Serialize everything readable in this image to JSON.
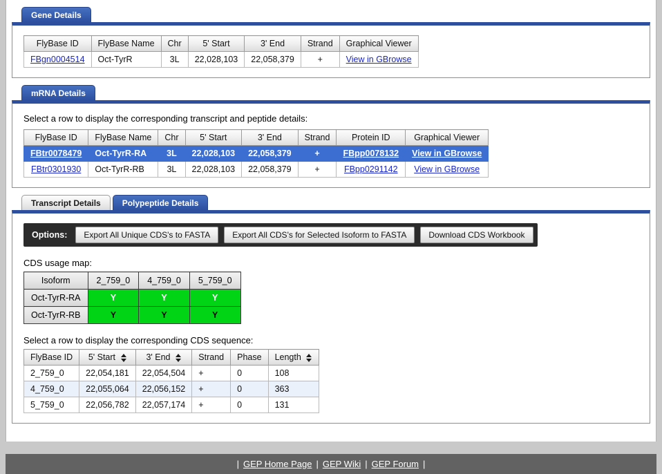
{
  "gene_panel": {
    "tab_label": "Gene Details",
    "columns": [
      "FlyBase ID",
      "FlyBase Name",
      "Chr",
      "5' Start",
      "3' End",
      "Strand",
      "Graphical Viewer"
    ],
    "rows": [
      {
        "flybase_id": "FBgn0004514",
        "flybase_name": "Oct-TyrR",
        "chr": "3L",
        "start": "22,028,103",
        "end": "22,058,379",
        "strand": "+",
        "viewer": "View in GBrowse"
      }
    ]
  },
  "mrna_panel": {
    "tab_label": "mRNA Details",
    "note": "Select a row to display the corresponding transcript and peptide details:",
    "columns": [
      "FlyBase ID",
      "FlyBase Name",
      "Chr",
      "5' Start",
      "3' End",
      "Strand",
      "Protein ID",
      "Graphical Viewer"
    ],
    "rows": [
      {
        "flybase_id": "FBtr0078479",
        "flybase_name": "Oct-TyrR-RA",
        "chr": "3L",
        "start": "22,028,103",
        "end": "22,058,379",
        "strand": "+",
        "protein_id": "FBpp0078132",
        "viewer": "View in GBrowse",
        "selected": true
      },
      {
        "flybase_id": "FBtr0301930",
        "flybase_name": "Oct-TyrR-RB",
        "chr": "3L",
        "start": "22,028,103",
        "end": "22,058,379",
        "strand": "+",
        "protein_id": "FBpp0291142",
        "viewer": "View in GBrowse",
        "selected": false
      }
    ]
  },
  "detail_panel": {
    "tabs": [
      {
        "label": "Transcript Details",
        "active": false
      },
      {
        "label": "Polypeptide Details",
        "active": true
      }
    ],
    "toolbar": {
      "label": "Options:",
      "buttons": [
        "Export All Unique CDS's to FASTA",
        "Export All CDS's for Selected Isoform to FASTA",
        "Download CDS Workbook"
      ]
    },
    "usage_map": {
      "title": "CDS usage map:",
      "columns": [
        "Isoform",
        "2_759_0",
        "4_759_0",
        "5_759_0"
      ],
      "rows": [
        {
          "isoform": "Oct-TyrR-RA",
          "cells": [
            "Y",
            "Y",
            "Y"
          ],
          "text_color": "white"
        },
        {
          "isoform": "Oct-TyrR-RB",
          "cells": [
            "Y",
            "Y",
            "Y"
          ],
          "text_color": "black"
        }
      ]
    },
    "cds_table": {
      "note": "Select a row to display the corresponding CDS sequence:",
      "columns": [
        {
          "label": "FlyBase ID",
          "sortable": false
        },
        {
          "label": "5' Start",
          "sortable": true
        },
        {
          "label": "3' End",
          "sortable": true
        },
        {
          "label": "Strand",
          "sortable": false
        },
        {
          "label": "Phase",
          "sortable": false
        },
        {
          "label": "Length",
          "sortable": true
        }
      ],
      "rows": [
        {
          "id": "2_759_0",
          "start": "22,054,181",
          "end": "22,054,504",
          "strand": "+",
          "phase": "0",
          "length": "108"
        },
        {
          "id": "4_759_0",
          "start": "22,055,064",
          "end": "22,056,152",
          "strand": "+",
          "phase": "0",
          "length": "363"
        },
        {
          "id": "5_759_0",
          "start": "22,056,782",
          "end": "22,057,174",
          "strand": "+",
          "phase": "0",
          "length": "131"
        }
      ]
    }
  },
  "footer": {
    "links": [
      "GEP Home Page",
      "GEP Wiki",
      "GEP Forum"
    ],
    "separator": "|"
  },
  "colors": {
    "tab_active": "#2d4f9e",
    "selected_row": "#3c6ed2",
    "usage_yes": "#00d415",
    "toolbar_bg": "#2b2b2b",
    "footer_bg": "#626262",
    "link": "#1a26c8"
  }
}
